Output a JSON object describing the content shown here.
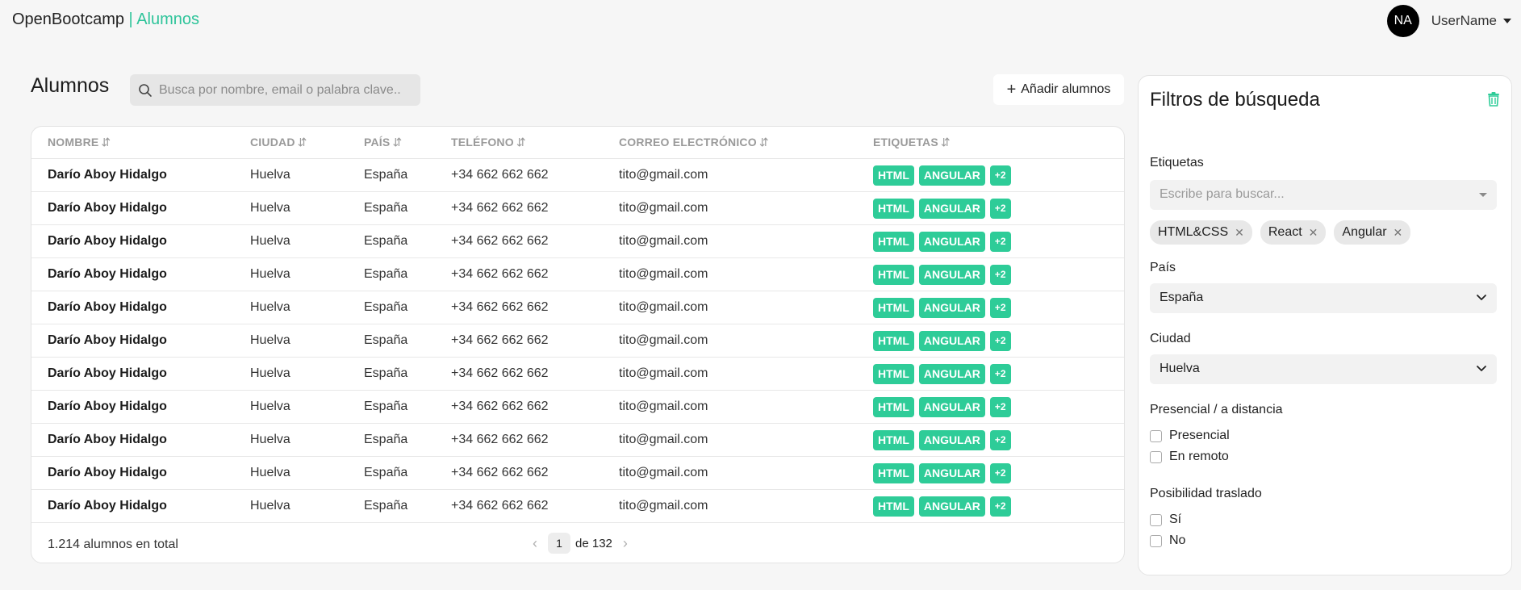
{
  "header": {
    "brand": "OpenBootcamp",
    "separator": "|",
    "section": "Alumnos",
    "avatar_initials": "NA",
    "user_name": "UserName"
  },
  "main": {
    "title": "Alumnos",
    "search_placeholder": "Busca por nombre, email o palabra clave...",
    "add_button": "Añadir alumnos",
    "columns": [
      "NOMBRE",
      "CIUDAD",
      "PAÍS",
      "TELÉFONO",
      "CORREO ELECTRÓNICO",
      "ETIQUETAS"
    ],
    "sort_glyph": "⇵",
    "rows": [
      {
        "name": "Darío Aboy Hidalgo",
        "city": "Huelva",
        "country": "España",
        "phone": "+34 662 662 662",
        "email": "tito@gmail.com",
        "tags": [
          "HTML",
          "ANGULAR"
        ],
        "more": "+2"
      },
      {
        "name": "Darío Aboy Hidalgo",
        "city": "Huelva",
        "country": "España",
        "phone": "+34 662 662 662",
        "email": "tito@gmail.com",
        "tags": [
          "HTML",
          "ANGULAR"
        ],
        "more": "+2"
      },
      {
        "name": "Darío Aboy Hidalgo",
        "city": "Huelva",
        "country": "España",
        "phone": "+34 662 662 662",
        "email": "tito@gmail.com",
        "tags": [
          "HTML",
          "ANGULAR"
        ],
        "more": "+2"
      },
      {
        "name": "Darío Aboy Hidalgo",
        "city": "Huelva",
        "country": "España",
        "phone": "+34 662 662 662",
        "email": "tito@gmail.com",
        "tags": [
          "HTML",
          "ANGULAR"
        ],
        "more": "+2"
      },
      {
        "name": "Darío Aboy Hidalgo",
        "city": "Huelva",
        "country": "España",
        "phone": "+34 662 662 662",
        "email": "tito@gmail.com",
        "tags": [
          "HTML",
          "ANGULAR"
        ],
        "more": "+2"
      },
      {
        "name": "Darío Aboy Hidalgo",
        "city": "Huelva",
        "country": "España",
        "phone": "+34 662 662 662",
        "email": "tito@gmail.com",
        "tags": [
          "HTML",
          "ANGULAR"
        ],
        "more": "+2"
      },
      {
        "name": "Darío Aboy Hidalgo",
        "city": "Huelva",
        "country": "España",
        "phone": "+34 662 662 662",
        "email": "tito@gmail.com",
        "tags": [
          "HTML",
          "ANGULAR"
        ],
        "more": "+2"
      },
      {
        "name": "Darío Aboy Hidalgo",
        "city": "Huelva",
        "country": "España",
        "phone": "+34 662 662 662",
        "email": "tito@gmail.com",
        "tags": [
          "HTML",
          "ANGULAR"
        ],
        "more": "+2"
      },
      {
        "name": "Darío Aboy Hidalgo",
        "city": "Huelva",
        "country": "España",
        "phone": "+34 662 662 662",
        "email": "tito@gmail.com",
        "tags": [
          "HTML",
          "ANGULAR"
        ],
        "more": "+2"
      },
      {
        "name": "Darío Aboy Hidalgo",
        "city": "Huelva",
        "country": "España",
        "phone": "+34 662 662 662",
        "email": "tito@gmail.com",
        "tags": [
          "HTML",
          "ANGULAR"
        ],
        "more": "+2"
      },
      {
        "name": "Darío Aboy Hidalgo",
        "city": "Huelva",
        "country": "España",
        "phone": "+34 662 662 662",
        "email": "tito@gmail.com",
        "tags": [
          "HTML",
          "ANGULAR"
        ],
        "more": "+2"
      }
    ],
    "total": "1.214 alumnos en total",
    "pagination": {
      "current": "1",
      "of_label": "de 132"
    }
  },
  "filters": {
    "title": "Filtros de búsqueda",
    "tags_label": "Etiquetas",
    "tags_placeholder": "Escribe para buscar...",
    "chips": [
      "HTML&CSS",
      "React",
      "Angular"
    ],
    "country_label": "País",
    "country_value": "España",
    "city_label": "Ciudad",
    "city_value": "Huelva",
    "mode_label": "Presencial / a distancia",
    "mode_options": [
      "Presencial",
      "En remoto"
    ],
    "relocate_label": "Posibilidad traslado",
    "relocate_options": [
      "Sí",
      "No"
    ]
  },
  "colors": {
    "accent": "#2ecc98",
    "brand": "#2ec49a"
  }
}
